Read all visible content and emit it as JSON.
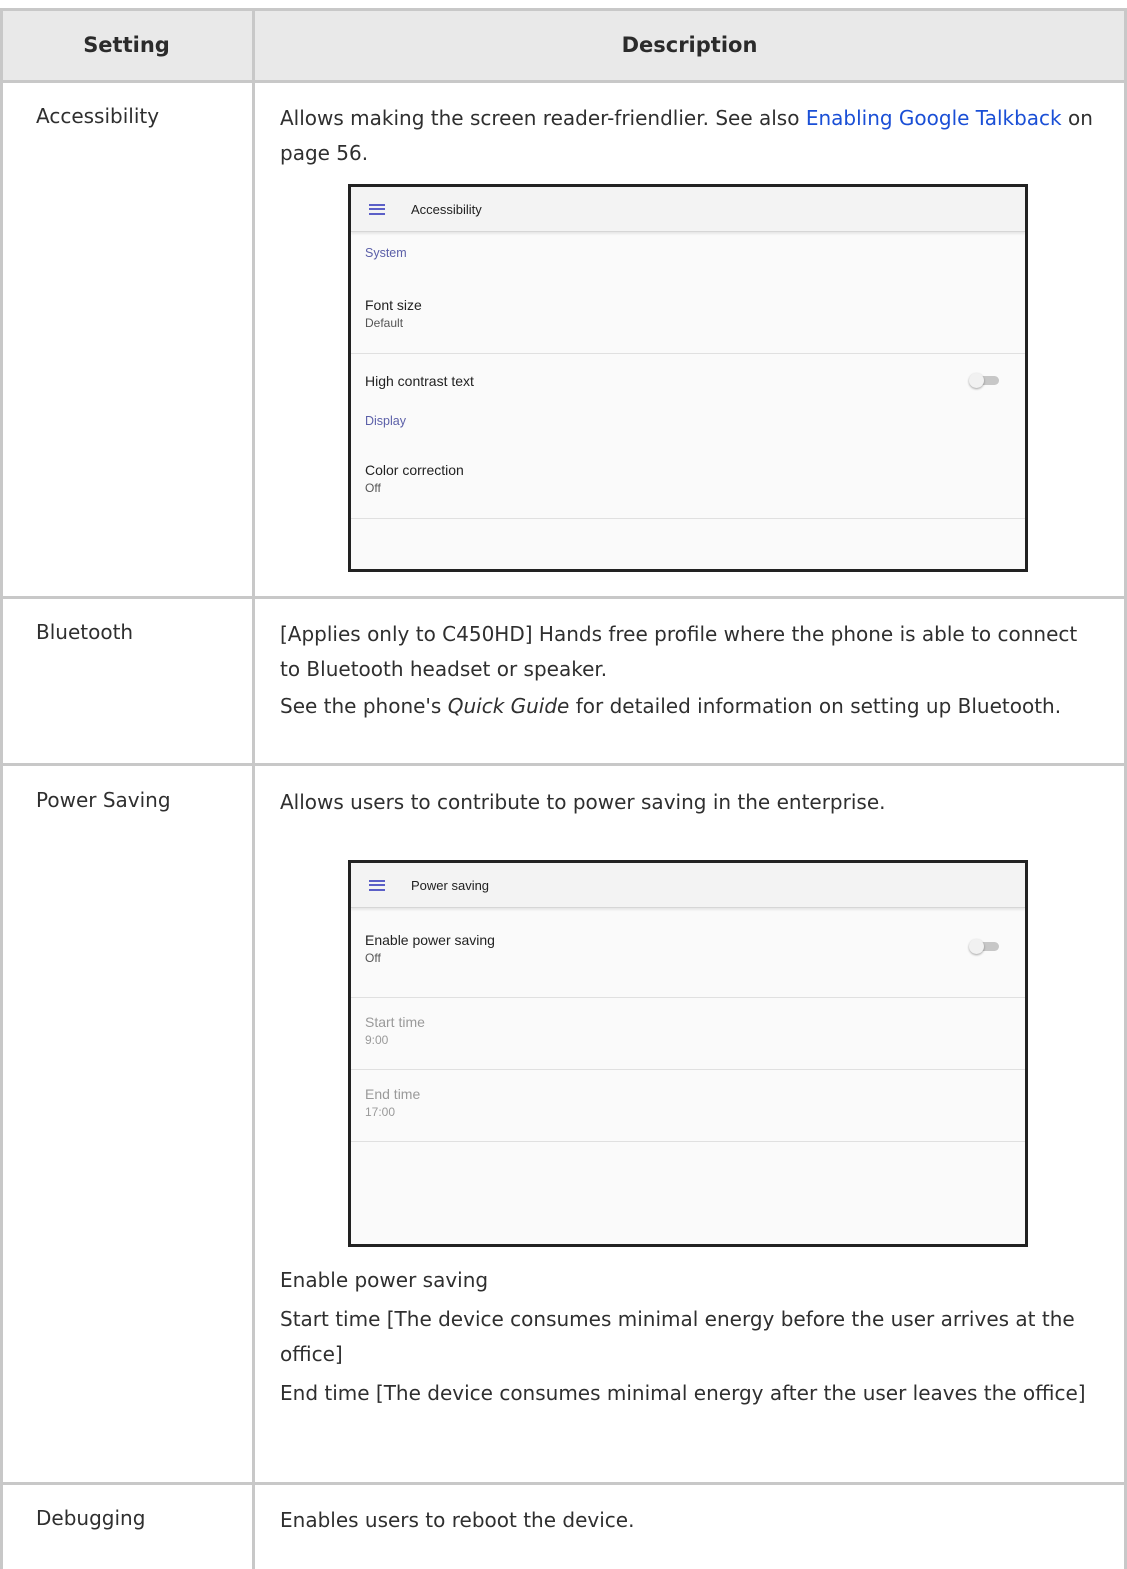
{
  "table": {
    "headers": {
      "setting": "Setting",
      "description": "Description"
    },
    "rows": {
      "accessibility": {
        "setting": "Accessibility",
        "desc_before": "Allows making the screen reader-friendlier. See also ",
        "link": "Enabling Google Talkback",
        "desc_after": " on page 56."
      },
      "bluetooth": {
        "setting": "Bluetooth",
        "p1": "[Applies only to C450HD]  Hands free profile where the phone is able to connect to Bluetooth headset or speaker.",
        "p2_before": "See the phone's ",
        "p2_em": "Quick Guide",
        "p2_after": " for detailed information on setting up Bluetooth."
      },
      "power_saving": {
        "setting": "Power Saving",
        "p1": "Allows users to contribute to power saving in the enterprise.",
        "p2": "Enable power saving",
        "p3": "Start time [The device consumes minimal energy before the user arrives at the office]",
        "p4": "End time [The device consumes minimal energy after the user leaves the office]"
      },
      "debugging": {
        "setting": "Debugging",
        "p1": "Enables users to reboot the device."
      }
    }
  },
  "screens": {
    "accessibility": {
      "title": "Accessibility",
      "icon": "hamburger-menu-icon",
      "section_system": "System",
      "font_size_title": "Font size",
      "font_size_value": "Default",
      "high_contrast_title": "High contrast text",
      "high_contrast_on": false,
      "section_display": "Display",
      "color_correction_title": "Color correction",
      "color_correction_value": "Off"
    },
    "power_saving": {
      "title": "Power saving",
      "icon": "hamburger-menu-icon",
      "enable_title": "Enable power saving",
      "enable_value": "Off",
      "enable_on": false,
      "start_title": "Start time",
      "start_value": "9:00",
      "end_title": "End time",
      "end_value": "17:00"
    }
  },
  "colors": {
    "link": "#1a4fd6",
    "section_header": "#5b5fa8",
    "menu_icon": "#5b5fc7",
    "table_header_bg": "#e9e9e9",
    "border": "#c8c8c8"
  }
}
